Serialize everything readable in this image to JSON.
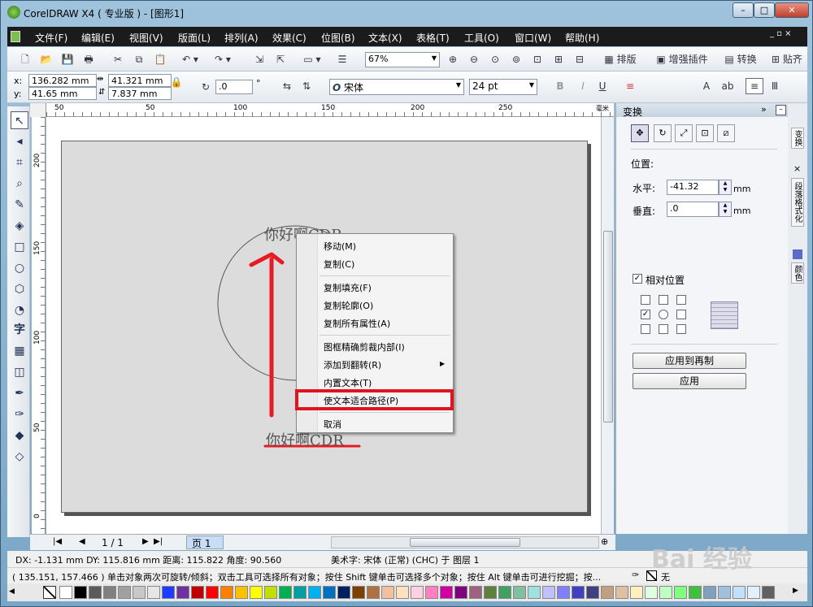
{
  "window": {
    "title": "CorelDRAW X4 ( 专业版 ) - [图形1]",
    "minimize": "–",
    "maximize": "□",
    "close": "✕"
  },
  "menubar": {
    "items": [
      "文件(F)",
      "编辑(E)",
      "视图(V)",
      "版面(L)",
      "排列(A)",
      "效果(C)",
      "位图(B)",
      "文本(X)",
      "表格(T)",
      "工具(O)",
      "窗口(W)",
      "帮助(H)"
    ]
  },
  "standard_toolbar": {
    "zoom": "67%",
    "labels": {
      "typeset": "排版",
      "enhance": "增强插件",
      "convert": "转换",
      "paste": "贴齐"
    }
  },
  "property_bar": {
    "x": "136.282 mm",
    "y": "41.65 mm",
    "width": "41.321 mm",
    "height": "7.837 mm",
    "angle": ".0",
    "angle_unit": "°",
    "font": "宋体",
    "size": "24 pt"
  },
  "ruler": {
    "h_ticks": [
      "50",
      "50",
      "100",
      "150",
      "200",
      "250"
    ],
    "h_unit": "毫米",
    "v_ticks": [
      "200",
      "150",
      "100",
      "50",
      "0"
    ]
  },
  "canvas": {
    "text_top": "你好啊CDR",
    "text_bottom": "你好啊CDR"
  },
  "context_menu": {
    "items": [
      "移动(M)",
      "复制(C)",
      "复制填充(F)",
      "复制轮廓(O)",
      "复制所有属性(A)",
      "图框精确剪裁内部(I)",
      "添加到翻转(R)",
      "内置文本(T)",
      "使文本适合路径(P)",
      "取消"
    ],
    "submenu_arrow": "▶",
    "highlighted_index": 8
  },
  "docker": {
    "title": "变换",
    "section_label": "位置:",
    "h_label": "水平:",
    "h_value": "-41.32",
    "v_label": "垂直:",
    "v_value": ".0",
    "unit": "mm",
    "relative_label": "相对位置",
    "apply_copy": "应用到再制",
    "apply": "应用",
    "side_tabs": [
      "变换",
      "段落格式化",
      "颜色"
    ]
  },
  "pagenav": {
    "page_count": "1 / 1",
    "page_tab": "页 1"
  },
  "status": {
    "line1_left": "DX: -1.131 mm DY: 115.816 mm 距离: 115.822 角度: 90.560",
    "line1_right": "美术字: 宋体 (正常) (CHC) 于 图层 1",
    "line2": "( 135.151, 157.466 )   单击对象两次可旋转/倾斜；双击工具可选择所有对象；按住 Shift 键单击可选择多个对象；按住 Alt 键单击可进行挖掘；按...",
    "fill_none": "无"
  },
  "watermark": "Bai 经验",
  "colors": {
    "highlight_box": "#e0141e",
    "arrow": "#e51c23",
    "menubar": "#1b1b1b"
  },
  "palette": [
    "#ffffff",
    "#000000",
    "#5a5a5a",
    "#808080",
    "#a0a0a0",
    "#c8c8c8",
    "#e6e6e6",
    "#1e3cff",
    "#7030a0",
    "#c00000",
    "#ff0000",
    "#ff8000",
    "#ffc000",
    "#ffff00",
    "#c0e000",
    "#00b050",
    "#00a0a0",
    "#00b0f0",
    "#0070c0",
    "#002060",
    "#7f3f00",
    "#b07040",
    "#f0c0a0",
    "#ffe0c0",
    "#ffd0e0",
    "#ff80c0",
    "#d000a0",
    "#800080",
    "#a06080",
    "#608040",
    "#40a060",
    "#80c0a0",
    "#a0e0e0",
    "#c0c0ff",
    "#8080ff",
    "#4040c0",
    "#404080",
    "#c0a080",
    "#e0c0a0",
    "#fff0c0",
    "#e0ffe0",
    "#c0ffc0",
    "#80ff80",
    "#40c040",
    "#80a0c0",
    "#a0c0e0",
    "#c0e0ff",
    "#e0f0ff",
    "#606060"
  ]
}
